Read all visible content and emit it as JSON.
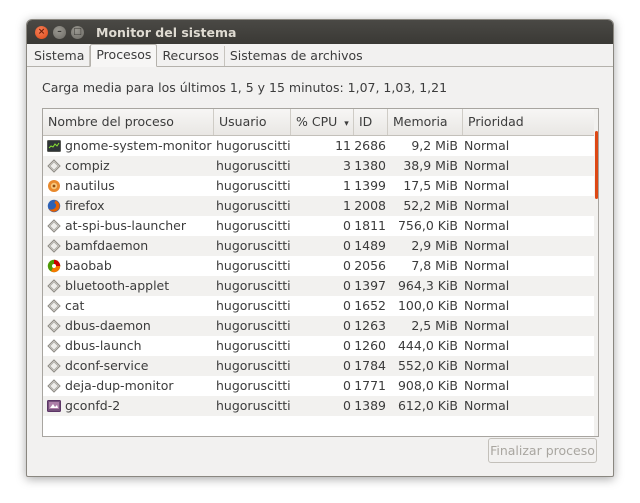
{
  "window": {
    "title": "Monitor del sistema",
    "close_glyph": "×",
    "minimize_glyph": "–",
    "maximize_glyph": "□"
  },
  "tabs": [
    {
      "label": "Sistema"
    },
    {
      "label": "Procesos"
    },
    {
      "label": "Recursos"
    },
    {
      "label": "Sistemas de archivos"
    }
  ],
  "active_tab": "Procesos",
  "load_text": "Carga media para los últimos 1, 5 y 15 minutos: 1,07, 1,03, 1,21",
  "table": {
    "columns": {
      "name": "Nombre del proceso",
      "user": "Usuario",
      "cpu": "% CPU",
      "cpu_sort_glyph": "▾",
      "id": "ID",
      "mem": "Memoria",
      "prio": "Prioridad"
    },
    "rows": [
      {
        "icon": "gnome-system-monitor-icon",
        "name": "gnome-system-monitor",
        "user": "hugoruscitti",
        "cpu": "11",
        "id": "2686",
        "mem": "9,2 MiB",
        "prio": "Normal"
      },
      {
        "icon": "generic-process-icon",
        "name": "compiz",
        "user": "hugoruscitti",
        "cpu": "3",
        "id": "1380",
        "mem": "38,9 MiB",
        "prio": "Normal"
      },
      {
        "icon": "nautilus-icon",
        "name": "nautilus",
        "user": "hugoruscitti",
        "cpu": "1",
        "id": "1399",
        "mem": "17,5 MiB",
        "prio": "Normal"
      },
      {
        "icon": "firefox-icon",
        "name": "firefox",
        "user": "hugoruscitti",
        "cpu": "1",
        "id": "2008",
        "mem": "52,2 MiB",
        "prio": "Normal"
      },
      {
        "icon": "generic-process-icon",
        "name": "at-spi-bus-launcher",
        "user": "hugoruscitti",
        "cpu": "0",
        "id": "1811",
        "mem": "756,0 KiB",
        "prio": "Normal"
      },
      {
        "icon": "generic-process-icon",
        "name": "bamfdaemon",
        "user": "hugoruscitti",
        "cpu": "0",
        "id": "1489",
        "mem": "2,9 MiB",
        "prio": "Normal"
      },
      {
        "icon": "baobab-icon",
        "name": "baobab",
        "user": "hugoruscitti",
        "cpu": "0",
        "id": "2056",
        "mem": "7,8 MiB",
        "prio": "Normal"
      },
      {
        "icon": "generic-process-icon",
        "name": "bluetooth-applet",
        "user": "hugoruscitti",
        "cpu": "0",
        "id": "1397",
        "mem": "964,3 KiB",
        "prio": "Normal"
      },
      {
        "icon": "generic-process-icon",
        "name": "cat",
        "user": "hugoruscitti",
        "cpu": "0",
        "id": "1652",
        "mem": "100,0 KiB",
        "prio": "Normal"
      },
      {
        "icon": "generic-process-icon",
        "name": "dbus-daemon",
        "user": "hugoruscitti",
        "cpu": "0",
        "id": "1263",
        "mem": "2,5 MiB",
        "prio": "Normal"
      },
      {
        "icon": "generic-process-icon",
        "name": "dbus-launch",
        "user": "hugoruscitti",
        "cpu": "0",
        "id": "1260",
        "mem": "444,0 KiB",
        "prio": "Normal"
      },
      {
        "icon": "generic-process-icon",
        "name": "dconf-service",
        "user": "hugoruscitti",
        "cpu": "0",
        "id": "1784",
        "mem": "552,0 KiB",
        "prio": "Normal"
      },
      {
        "icon": "generic-process-icon",
        "name": "deja-dup-monitor",
        "user": "hugoruscitti",
        "cpu": "0",
        "id": "1771",
        "mem": "908,0 KiB",
        "prio": "Normal"
      },
      {
        "icon": "gconfd-icon",
        "name": "gconfd-2",
        "user": "hugoruscitti",
        "cpu": "0",
        "id": "1389",
        "mem": "612,0 KiB",
        "prio": "Normal"
      }
    ]
  },
  "end_process_label": "Finalizar proceso",
  "colors": {
    "accent": "#dd4814",
    "titlebar": "#3c3b37",
    "alt_row": "#f2f1ef"
  }
}
